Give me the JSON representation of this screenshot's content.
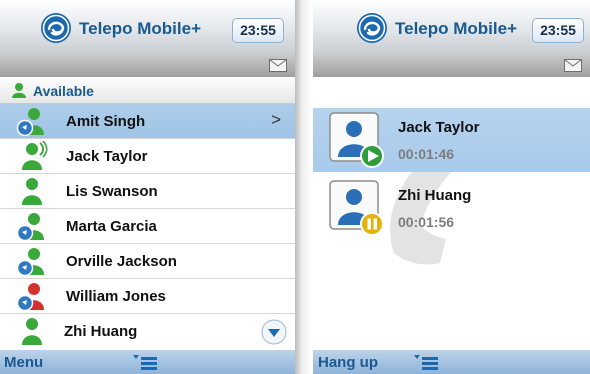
{
  "brand": {
    "name": "Telepo Mobile+",
    "color": "#1a5a8f"
  },
  "status": {
    "time": "23:55"
  },
  "contacts_screen": {
    "section_label": "Available",
    "contacts": [
      {
        "name": "Amit Singh",
        "presence": "available-mobile",
        "selected": true
      },
      {
        "name": "Jack Taylor",
        "presence": "on-phone"
      },
      {
        "name": "Lis Swanson",
        "presence": "available"
      },
      {
        "name": "Marta Garcia",
        "presence": "available-mobile"
      },
      {
        "name": "Orville Jackson",
        "presence": "available-mobile"
      },
      {
        "name": "William Jones",
        "presence": "busy"
      },
      {
        "name": "Zhi Huang",
        "presence": "available"
      }
    ],
    "footer_label": "Menu"
  },
  "calls_screen": {
    "calls": [
      {
        "name": "Jack Taylor",
        "duration": "00:01:46",
        "state": "active"
      },
      {
        "name": "Zhi Huang",
        "duration": "00:01:56",
        "state": "on-hold"
      }
    ],
    "footer_label": "Hang up"
  },
  "icons": {
    "logo": "telepo-logo-icon",
    "mail": "envelope-icon",
    "chevron": "chevron-right-icon",
    "scroll": "scroll-down-icon",
    "menu": "menu-list-icon",
    "play": "play-icon",
    "pause": "pause-icon"
  },
  "colors": {
    "selected_row": "#a8caeb",
    "footer": "#8fb3d9",
    "presence_green": "#3aa83a",
    "presence_red": "#d43030",
    "play_badge": "#2e9e3a",
    "pause_badge": "#e4b20c"
  }
}
